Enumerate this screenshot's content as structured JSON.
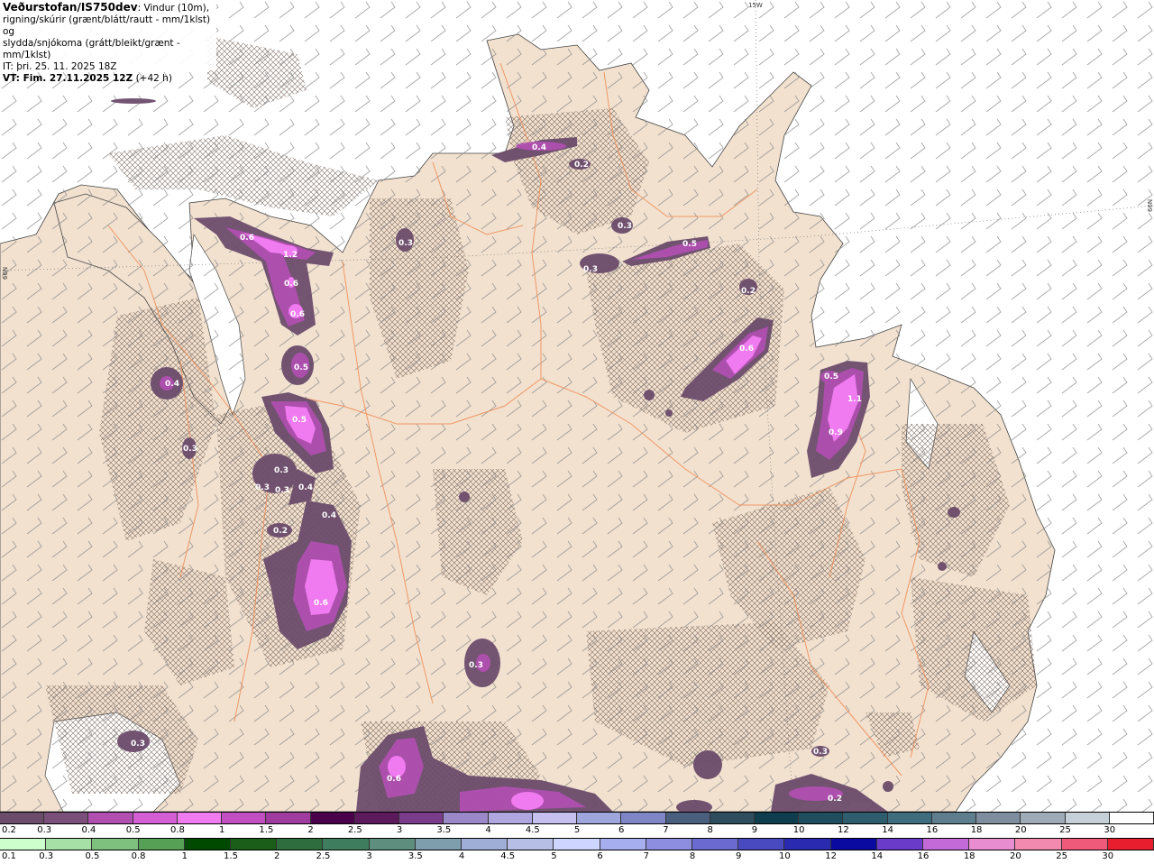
{
  "header": {
    "title": "Veðurstofan/IS750dev",
    "desc1": ": Vindur (10m),",
    "desc2": "rigning/skúrir (grænt/blátt/rautt - mm/1klst) og",
    "desc3": "slydda/snjókoma (grátt/bleikt/grænt - mm/1klst)",
    "it": "IT: þri. 25. 11. 2025 18Z",
    "vt": "VT: Fim. 27.11.2025 12Z",
    "lead": " (+42 h)"
  },
  "grid_labels": {
    "lon": "15W",
    "lat_left": "66N",
    "lat_right": "66N"
  },
  "precip_labels": [
    {
      "text": "0.4"
    },
    {
      "text": "0.2"
    },
    {
      "text": "0.3"
    },
    {
      "text": "0.5"
    },
    {
      "text": "0.3"
    },
    {
      "text": "0.3"
    },
    {
      "text": "0.6"
    },
    {
      "text": "1.2"
    },
    {
      "text": "0.6"
    },
    {
      "text": "0.6"
    },
    {
      "text": "0.5"
    },
    {
      "text": "0.2"
    },
    {
      "text": "0.6"
    },
    {
      "text": "0.5"
    },
    {
      "text": "1.1"
    },
    {
      "text": "0.9"
    },
    {
      "text": "0.4"
    },
    {
      "text": "0.3"
    },
    {
      "text": "0.5"
    },
    {
      "text": "0.3"
    },
    {
      "text": "0.3"
    },
    {
      "text": "0.4"
    },
    {
      "text": "0.3"
    },
    {
      "text": "0.4"
    },
    {
      "text": "0.2"
    },
    {
      "text": "0.6"
    },
    {
      "text": "0.3"
    },
    {
      "text": "0.3"
    },
    {
      "text": "0.6"
    },
    {
      "text": "0.3"
    },
    {
      "text": "0.2"
    }
  ],
  "legend_snow": {
    "labels": [
      "0.2",
      "0.3",
      "0.4",
      "0.5",
      "0.8",
      "1",
      "1.5",
      "2",
      "2.5",
      "3",
      "3.5",
      "4",
      "4.5",
      "5",
      "6",
      "7",
      "8",
      "9",
      "10",
      "12",
      "14",
      "16",
      "18",
      "20",
      "25",
      "30"
    ],
    "colors": [
      "#6b4c6b",
      "#7a4f7a",
      "#b04fb0",
      "#d45ed4",
      "#f07af0",
      "#c24fc2",
      "#a03ca0",
      "#4a004a",
      "#5c1a5c",
      "#7a3c8a",
      "#9a88c8",
      "#b0a6e0",
      "#c6c0ee",
      "#9ea6dc",
      "#7e86c6",
      "#4a5e7e",
      "#2e4e5e",
      "#0e3e4e",
      "#1e4e5e",
      "#2e5e6e",
      "#3e6e7e",
      "#5e7e8e",
      "#7e8e9e",
      "#9eaab6",
      "#c6d0d8",
      "#ffffff"
    ]
  },
  "legend_rain": {
    "labels": [
      "0.1",
      "0.3",
      "0.5",
      "0.8",
      "1",
      "1.5",
      "2",
      "2.5",
      "3",
      "3.5",
      "4",
      "4.5",
      "5",
      "6",
      "7",
      "8",
      "9",
      "10",
      "12",
      "14",
      "16",
      "18",
      "20",
      "25",
      "30"
    ],
    "colors": [
      "#ccffcc",
      "#a6e0a6",
      "#7ec07e",
      "#56a056",
      "#004a00",
      "#1a5e1a",
      "#2e6e3e",
      "#3e7e5e",
      "#5e8e7e",
      "#7e9eae",
      "#9eaed6",
      "#b6bee6",
      "#ced6ff",
      "#a6aef0",
      "#8e8ee0",
      "#6a6ad0",
      "#4a4ac0",
      "#2a2ab0",
      "#0a0aa0",
      "#6a3ac8",
      "#c46ad8",
      "#e88ed0",
      "#f28ab0",
      "#f05a7a",
      "#e81e2e"
    ]
  },
  "colors": {
    "land": "#f2e1cf",
    "sea": "#ffffff",
    "road": "#f0905a",
    "precip_light": "#6b4c6b",
    "precip_mid": "#b04fb0",
    "precip_high": "#f07af0"
  }
}
